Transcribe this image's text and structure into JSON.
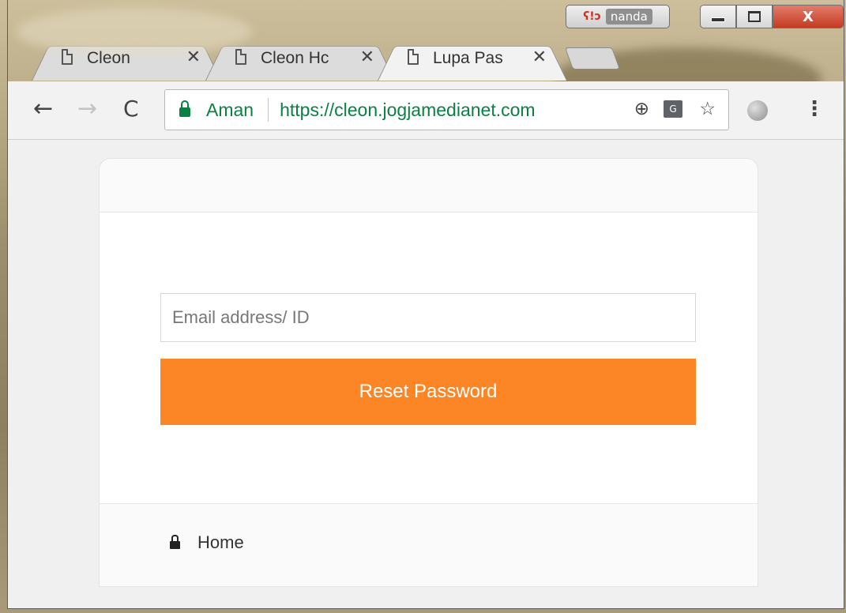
{
  "window": {
    "profile": {
      "icon": "profile-avatar-icon",
      "name": "nanda"
    },
    "controls": {
      "minimize": "minimize-icon",
      "maximize": "maximize-icon",
      "close_label": "X"
    }
  },
  "tabs": [
    {
      "title": "Cleon",
      "icon": "document-icon",
      "close": "✕",
      "active": false
    },
    {
      "title": "Cleon Hc",
      "icon": "document-icon",
      "close": "✕",
      "active": false
    },
    {
      "title": "Lupa Pas",
      "icon": "document-icon",
      "close": "✕",
      "active": true
    }
  ],
  "toolbar": {
    "back": "←",
    "forward": "→",
    "reload": "C",
    "secure_label": "Aman",
    "url": "https://cleon.jogjamedianet.com",
    "zoom": "⊕",
    "translate": "G",
    "bookmark": "☆",
    "menu": "⋮"
  },
  "form": {
    "email_placeholder": "Email address/ ID",
    "email_value": "",
    "submit_label": "Reset Password",
    "submit_color": "#fc8626"
  },
  "footer": {
    "home_label": "Home",
    "home_icon": "lock-icon"
  }
}
